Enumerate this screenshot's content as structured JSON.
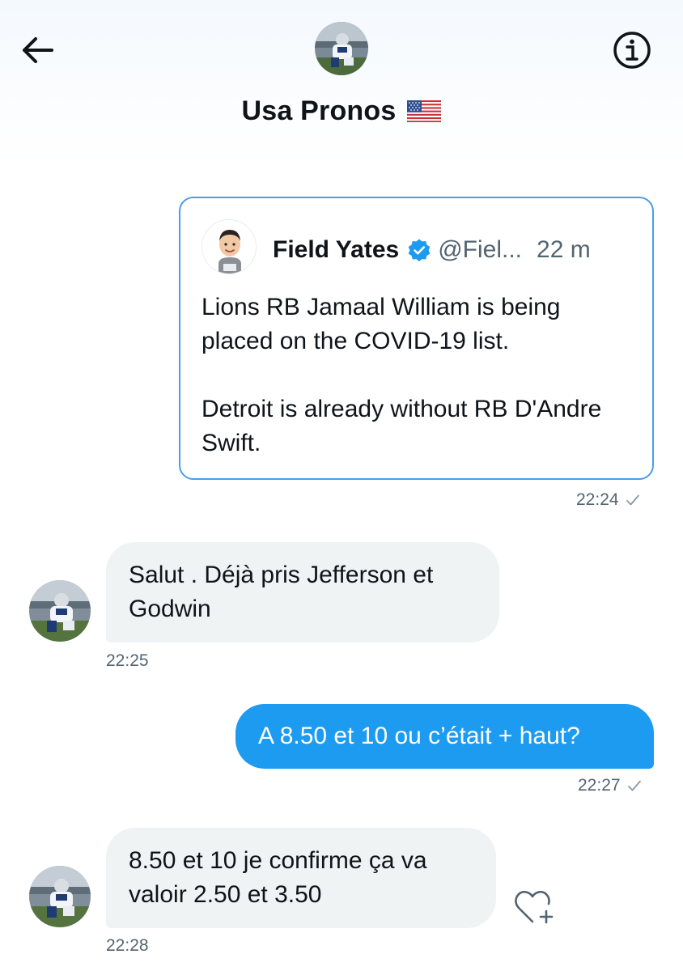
{
  "header": {
    "title": "Usa Pronos",
    "back_icon": "arrow-left-icon",
    "info_icon": "info-circle-icon",
    "flag_icon": "us-flag-emoji"
  },
  "quoted_tweet": {
    "author_name": "Field Yates",
    "handle": "@Fiel...",
    "age": "22 m",
    "verified_icon": "verified-badge-icon",
    "verified_color": "#1d9bf0",
    "text_lines": [
      "Lions RB Jamaal William is being placed on the COVID-19 list.",
      "Detroit is already without RB D'Andre Swift."
    ],
    "border_color": "#4a9ee8"
  },
  "messages": [
    {
      "direction": "outgoing",
      "type": "quoted-tweet",
      "time": "22:24",
      "status_icon": "sent-check-icon"
    },
    {
      "direction": "incoming",
      "type": "text",
      "text": "Salut . Déjà pris Jefferson et Godwin",
      "time": "22:25"
    },
    {
      "direction": "outgoing",
      "type": "text",
      "text": "A 8.50 et 10 ou c’était + haut?",
      "time": "22:27",
      "status_icon": "sent-check-icon"
    },
    {
      "direction": "incoming",
      "type": "text",
      "text": "8.50 et 10 je confirme ça va valoir 2.50 et 3.50",
      "time": "22:28",
      "reaction_icon": "add-reaction-heart-icon"
    }
  ],
  "colors": {
    "outgoing_bubble": "#1d9bf0",
    "incoming_bubble": "#eff3f4",
    "secondary_text": "#536471",
    "primary_text": "#0f1419"
  }
}
